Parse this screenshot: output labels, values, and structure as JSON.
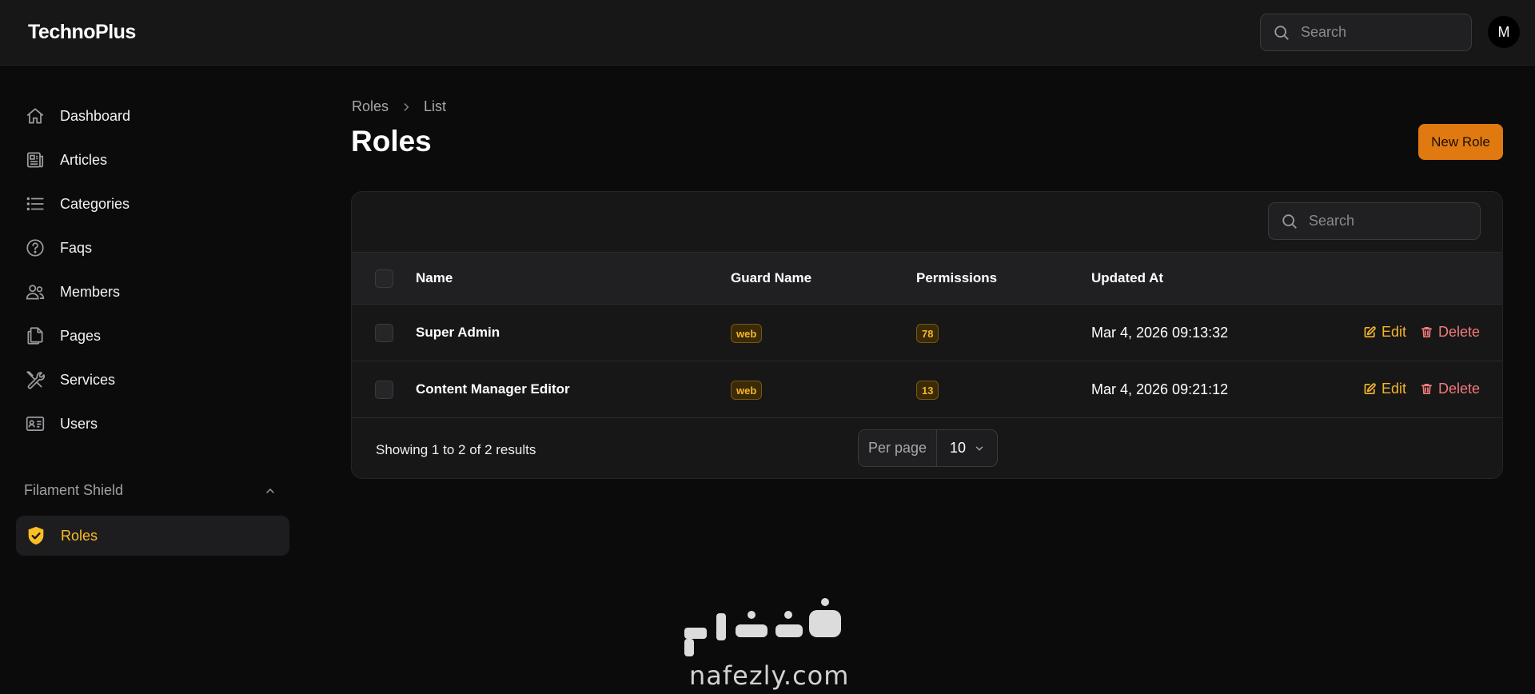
{
  "app": {
    "brand": "TechnoPlus",
    "avatar_initial": "M"
  },
  "top_search": {
    "placeholder": "Search"
  },
  "sidebar": {
    "items": [
      {
        "label": "Dashboard",
        "icon": "home-icon"
      },
      {
        "label": "Articles",
        "icon": "newspaper-icon"
      },
      {
        "label": "Categories",
        "icon": "list-icon"
      },
      {
        "label": "Faqs",
        "icon": "question-circle-icon"
      },
      {
        "label": "Members",
        "icon": "users-icon"
      },
      {
        "label": "Pages",
        "icon": "documents-icon"
      },
      {
        "label": "Services",
        "icon": "wrench-screwdriver-icon"
      },
      {
        "label": "Users",
        "icon": "id-card-icon"
      }
    ],
    "group": {
      "label": "Filament Shield",
      "items": [
        {
          "label": "Roles",
          "icon": "shield-check-icon",
          "active": true
        }
      ]
    }
  },
  "breadcrumb": {
    "items": [
      "Roles",
      "List"
    ]
  },
  "page": {
    "title": "Roles",
    "new_button": "New Role"
  },
  "table": {
    "search_placeholder": "Search",
    "columns": [
      "Name",
      "Guard Name",
      "Permissions",
      "Updated At"
    ],
    "rows": [
      {
        "name": "Super Admin",
        "guard": "web",
        "permissions": "78",
        "updated_at": "Mar 4, 2026 09:13:32"
      },
      {
        "name": "Content Manager Editor",
        "guard": "web",
        "permissions": "13",
        "updated_at": "Mar 4, 2026 09:21:12"
      }
    ],
    "actions": {
      "edit": "Edit",
      "delete": "Delete"
    },
    "footer": {
      "summary": "Showing 1 to 2 of 2 results",
      "per_page_label": "Per page",
      "per_page_value": "10"
    }
  },
  "watermark": {
    "arabic": "نفذلي",
    "latin": "nafezly.com"
  },
  "colors": {
    "accent": "#fbbf24",
    "primary_button": "#e07a10",
    "danger": "#f47a7a",
    "background": "#0b0b0c"
  }
}
